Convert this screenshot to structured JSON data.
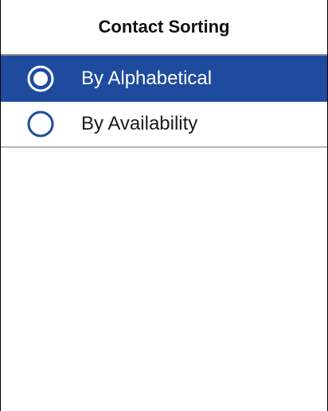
{
  "header": {
    "title": "Contact Sorting"
  },
  "options": [
    {
      "label": "By Alphabetical",
      "selected": true
    },
    {
      "label": "By Availability",
      "selected": false
    }
  ],
  "colors": {
    "selected_background": "#1e4b9e",
    "selected_text": "#ffffff",
    "radio_unselected": "#1e4b9e"
  },
  "icons": {
    "selected": "radio-selected-icon",
    "unselected": "radio-unselected-icon"
  }
}
